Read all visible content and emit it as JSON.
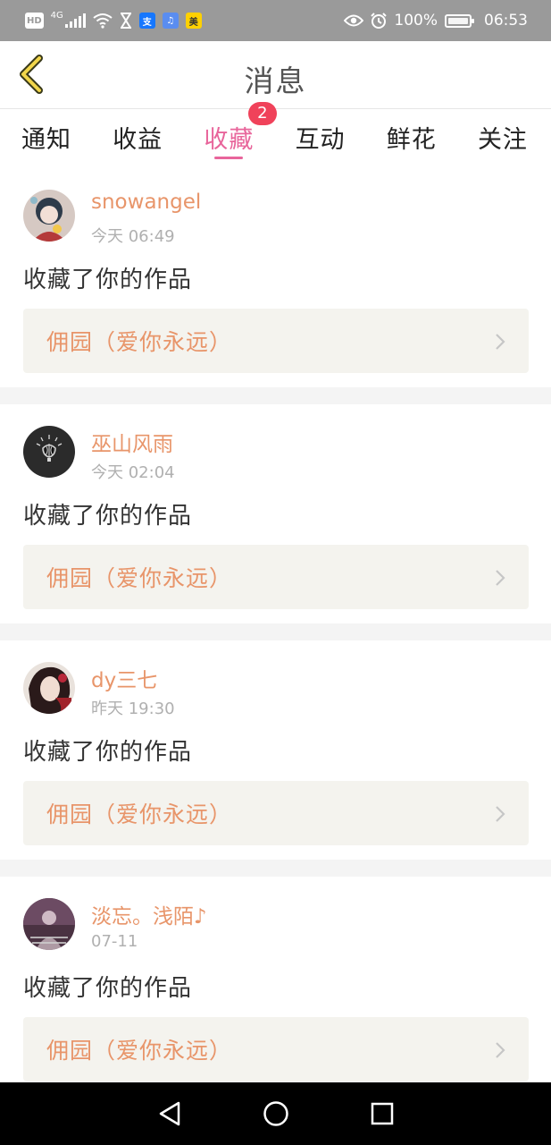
{
  "status_bar": {
    "left_badges": [
      "HD",
      "4G"
    ],
    "battery": "100%",
    "time": "06:53",
    "icons": [
      "hd-icon",
      "signal-icon",
      "wifi-icon",
      "hourglass-icon",
      "alipay-icon",
      "music-icon",
      "meituan-icon",
      "eye-icon",
      "alarm-icon",
      "battery-icon"
    ]
  },
  "header": {
    "title": "消息",
    "back_icon": "chevron-left-icon"
  },
  "tabs": [
    {
      "label": "通知"
    },
    {
      "label": "收益"
    },
    {
      "label": "收藏",
      "badge": "2",
      "active": true
    },
    {
      "label": "互动"
    },
    {
      "label": "鲜花"
    },
    {
      "label": "关注"
    }
  ],
  "messages": [
    {
      "username": "snowangel",
      "time": "今天 06:49",
      "action": "收藏了你的作品",
      "work": "佣园（爱你永远）"
    },
    {
      "username": "巫山风雨",
      "time": "今天 02:04",
      "action": "收藏了你的作品",
      "work": "佣园（爱你永远）"
    },
    {
      "username": "dy三七",
      "time": "昨天 19:30",
      "action": "收藏了你的作品",
      "work": "佣园（爱你永远）"
    },
    {
      "username": "淡忘。浅陌♪",
      "time": "07-11",
      "action": "收藏了你的作品",
      "work": "佣园（爱你永远）"
    }
  ],
  "colors": {
    "accent_pink": "#e8659b",
    "username_orange": "#e8956a",
    "badge_red": "#f0425a",
    "statusbar_gray": "#9a9a9a",
    "work_bg": "#f4f3ee"
  },
  "nav_icons": [
    "back-triangle-icon",
    "home-circle-icon",
    "recents-square-icon"
  ]
}
